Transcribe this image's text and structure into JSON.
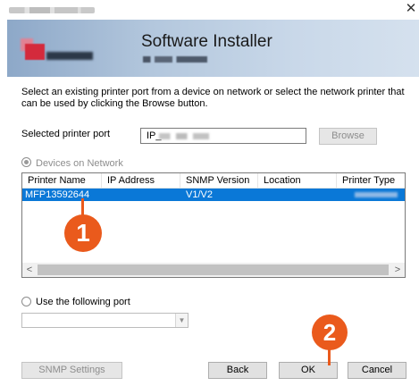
{
  "window": {
    "close_glyph": "✕"
  },
  "header": {
    "title": "Software Installer"
  },
  "instructions": "Select an existing printer port from a device on network or select the network printer that can be used by clicking the Browse button.",
  "selected_port": {
    "label": "Selected printer port",
    "value": "IP_",
    "browse_label": "Browse"
  },
  "devices_on_network": {
    "label": "Devices on Network",
    "checked": true,
    "disabled": true
  },
  "device_list": {
    "columns": [
      "Printer Name",
      "IP Address",
      "SNMP Version",
      "Location",
      "Printer Type"
    ],
    "rows": [
      {
        "printer_name": "MFP13592644",
        "ip_address": "",
        "snmp_version": "V1/V2",
        "location": "",
        "printer_type": ""
      }
    ],
    "scroll_left": "<",
    "scroll_right": ">"
  },
  "use_following_port": {
    "label": "Use the following port",
    "checked": false,
    "dropdown_value": "",
    "dropdown_arrow": "▼"
  },
  "buttons": {
    "snmp_settings": "SNMP Settings",
    "back": "Back",
    "ok": "OK",
    "cancel": "Cancel"
  },
  "annotations": {
    "step1": "1",
    "step2": "2"
  },
  "colors": {
    "selection": "#0a78d7",
    "marker": "#ea5a1c",
    "header_gradient_start": "#8da8c8"
  }
}
